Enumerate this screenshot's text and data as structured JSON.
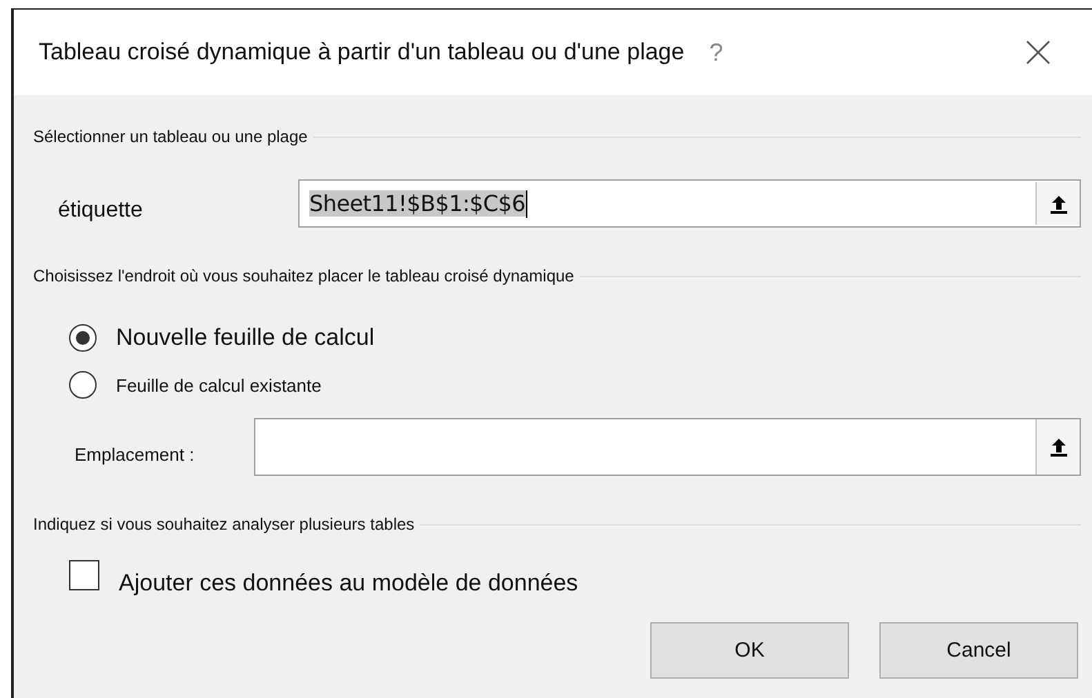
{
  "window": {
    "title": "Tableau croisé dynamique à partir d'un tableau ou d'une plage",
    "help": "?"
  },
  "source": {
    "heading": "Sélectionner un tableau ou une plage",
    "label": "étiquette",
    "value": "Sheet11!$B$1:$C$6"
  },
  "destination": {
    "heading": "Choisissez l'endroit où vous souhaitez placer le tableau croisé dynamique",
    "options": [
      {
        "label": "Nouvelle feuille de calcul",
        "selected": true
      },
      {
        "label": "Feuille de calcul existante",
        "selected": false
      }
    ],
    "location_label": "Emplacement :"
  },
  "multiple": {
    "heading": "Indiquez si vous souhaitez analyser plusieurs tables",
    "checkbox": {
      "label": "Ajouter ces données au modèle de données",
      "checked": false
    }
  },
  "buttons": [
    "OK",
    "Cancel"
  ]
}
